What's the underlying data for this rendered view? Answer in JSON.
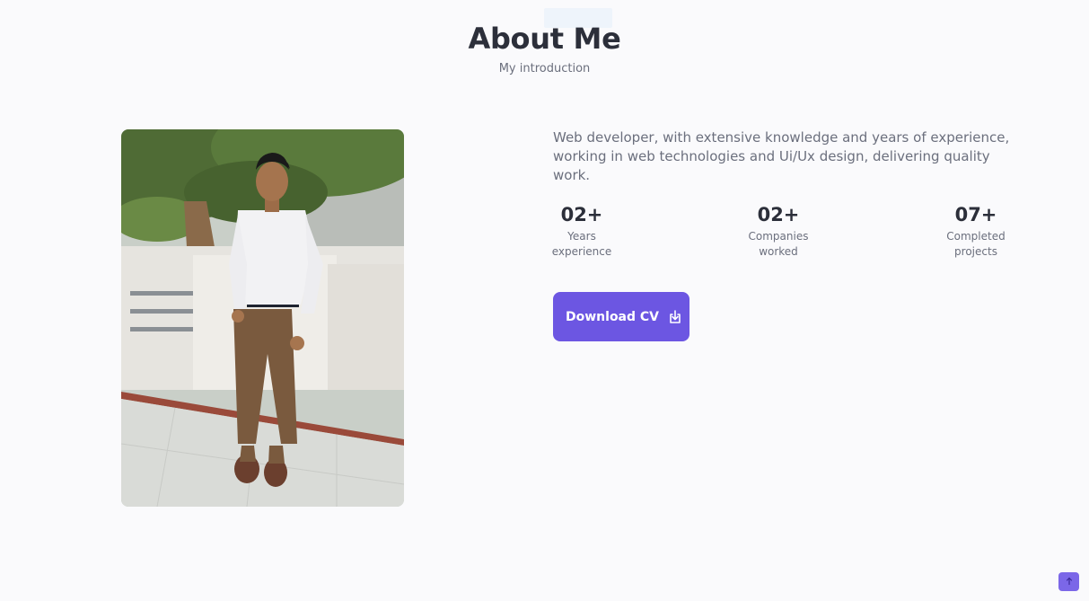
{
  "header": {
    "title": "About Me",
    "subtitle": "My introduction"
  },
  "photo": {
    "icon": "profile-photo"
  },
  "about": {
    "description": "Web developer, with extensive knowledge and years of experience, working in web technologies and Ui/Ux design, delivering quality work."
  },
  "stats": [
    {
      "value": "02+",
      "label_line1": "Years",
      "label_line2": "experience"
    },
    {
      "value": "02+",
      "label_line1": "Companies",
      "label_line2": "worked"
    },
    {
      "value": "07+",
      "label_line1": "Completed",
      "label_line2": "projects"
    }
  ],
  "download": {
    "label": "Download CV",
    "icon": "download-icon"
  },
  "scroll_top": {
    "icon": "arrow-up-icon"
  },
  "colors": {
    "accent": "#6c56e2",
    "background": "#fafafc",
    "heading": "#2c2f3a",
    "text": "#6b6f7d"
  }
}
